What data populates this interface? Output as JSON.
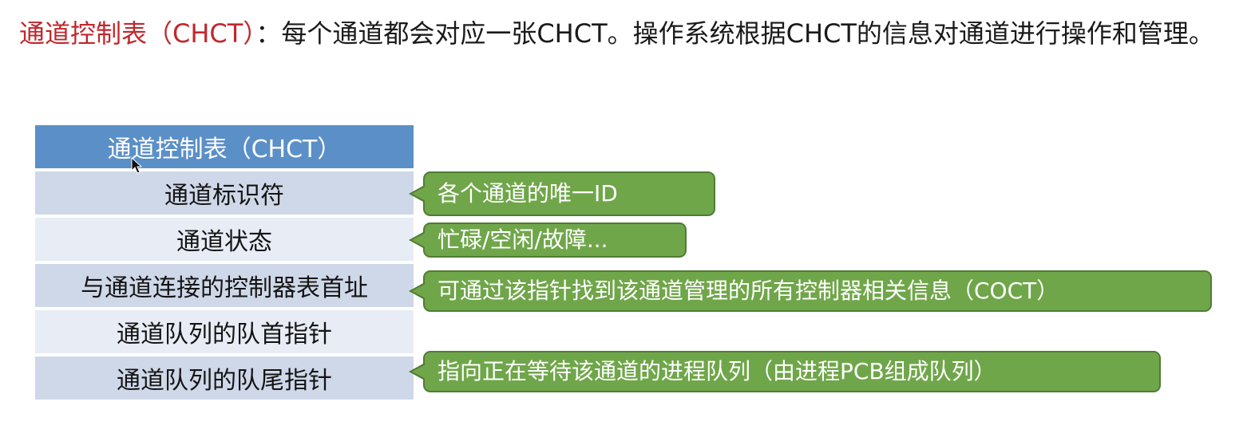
{
  "intro": {
    "term": "通道控制表（CHCT）",
    "sentence": "：每个通道都会对应一张CHCT。操作系统根据CHCT的信息对通道进行操作和管理。"
  },
  "table": {
    "header": "通道控制表（CHCT）",
    "rows": [
      "通道标识符",
      "通道状态",
      "与通道连接的控制器表首址",
      "通道队列的队首指针",
      "通道队列的队尾指针"
    ]
  },
  "callouts": [
    "各个通道的唯一ID",
    "忙碌/空闲/故障...",
    "可通过该指针找到该通道管理的所有控制器相关信息（COCT）",
    "指向正在等待该通道的进程队列（由进程PCB组成队列）"
  ],
  "colors": {
    "term": "#c0282e",
    "header": "#5b8fc7",
    "row_dark": "#cfd8e8",
    "row_light": "#e7ecf5",
    "callout": "#70a64a"
  }
}
